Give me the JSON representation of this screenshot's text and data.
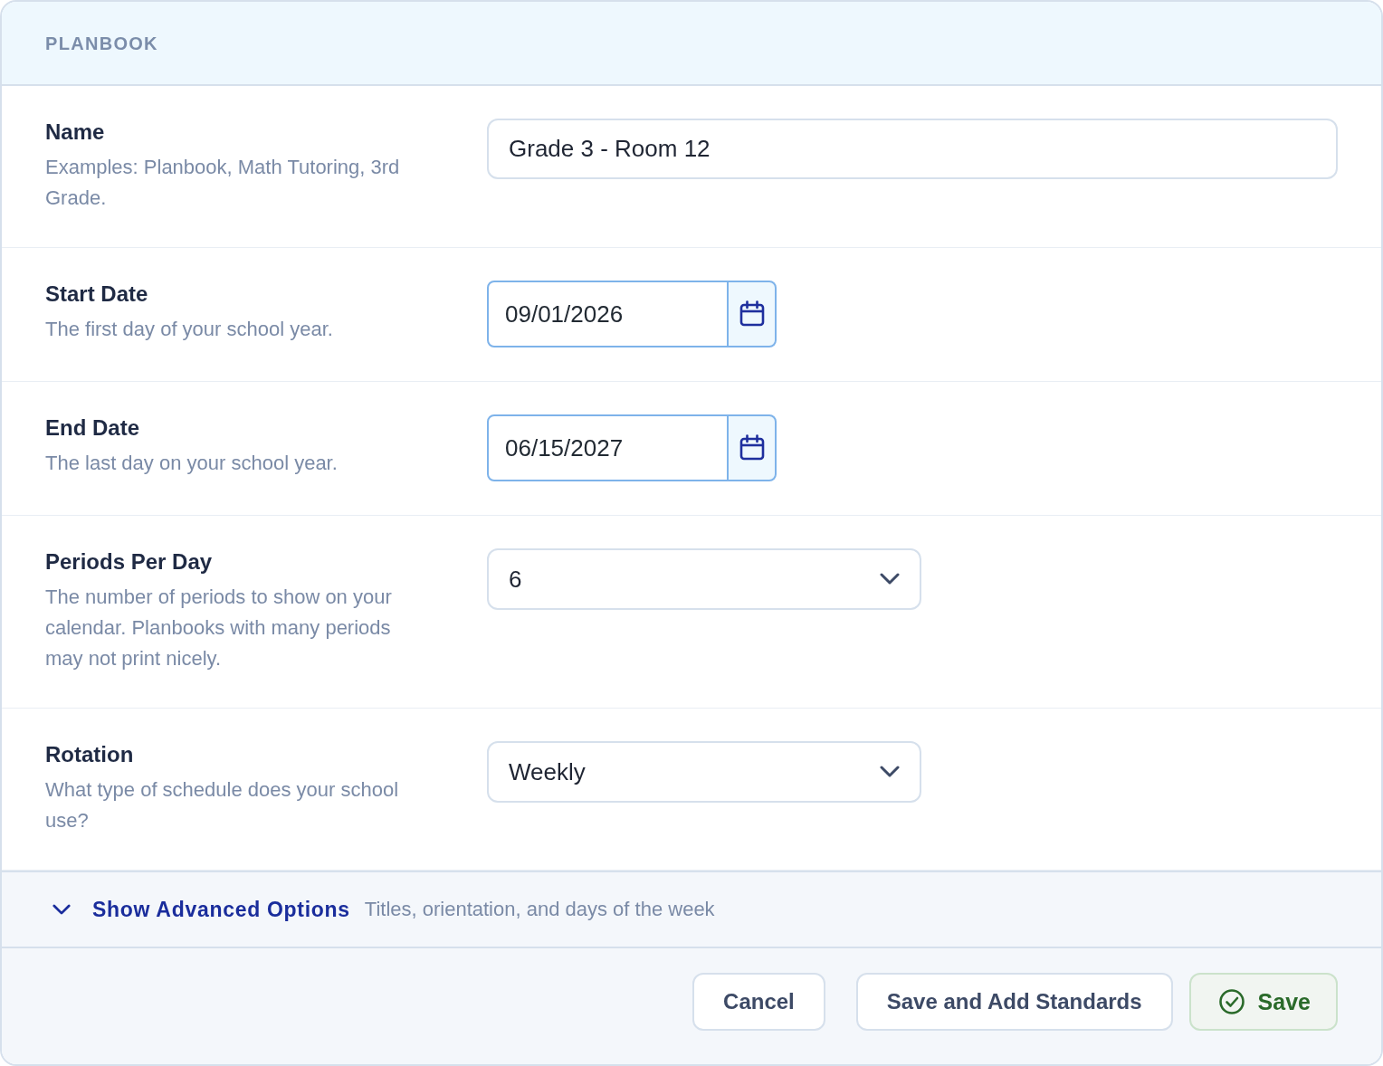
{
  "card": {
    "title": "PLANBOOK"
  },
  "fields": [
    {
      "kind": "text",
      "label": "Name",
      "description": "Examples: Planbook, Math Tutoring, 3rd Grade.",
      "value": "Grade 3 - Room 12"
    },
    {
      "kind": "date",
      "label": "Start Date",
      "description": "The first day of your school year.",
      "value": "09/01/2026"
    },
    {
      "kind": "date",
      "label": "End Date",
      "description": "The last day on your school year.",
      "value": "06/15/2027"
    },
    {
      "kind": "select",
      "label": "Periods Per Day",
      "description": "The number of periods to show on your calendar. Planbooks with many periods may not print nicely.",
      "value": "6"
    },
    {
      "kind": "select",
      "label": "Rotation",
      "description": "What type of schedule does your school use?",
      "value": "Weekly"
    }
  ],
  "advanced": {
    "label": "Show Advanced Options",
    "description": "Titles, orientation, and days of the week",
    "expanded": false
  },
  "buttons": [
    {
      "kind": "secondary",
      "label": "Cancel"
    },
    {
      "kind": "secondary",
      "label": "Save and Add Standards"
    },
    {
      "kind": "primary",
      "label": "Save"
    }
  ]
}
